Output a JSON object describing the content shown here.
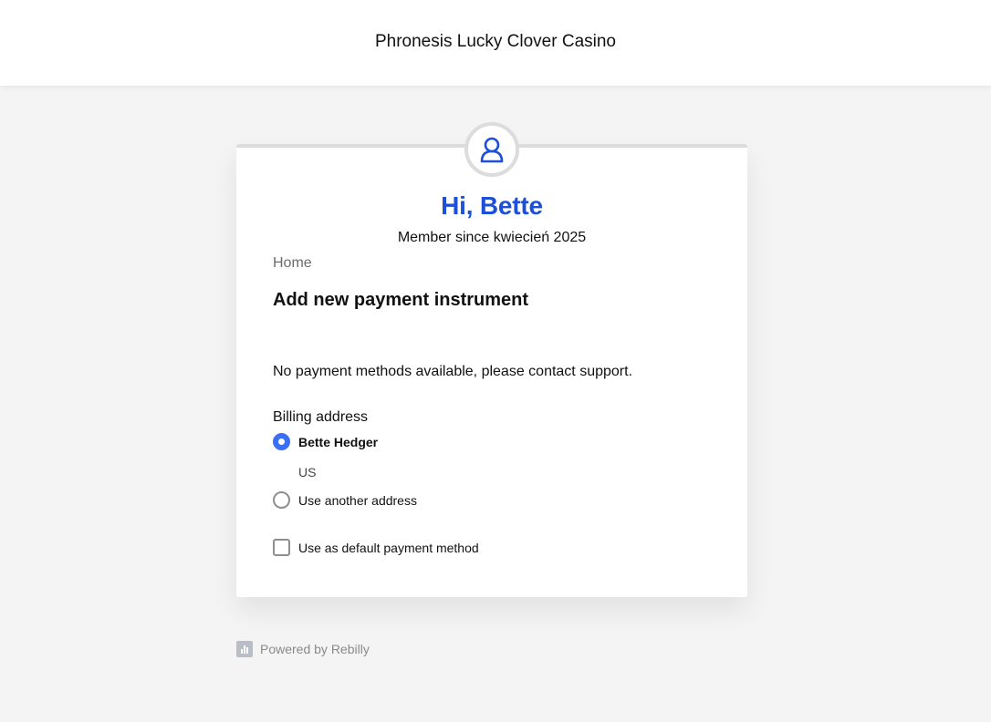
{
  "header": {
    "title": "Phronesis Lucky Clover Casino"
  },
  "profile": {
    "avatar_icon": "user-icon",
    "greeting": "Hi, Bette",
    "member_since": "Member since kwiecień 2025"
  },
  "breadcrumb": {
    "home": "Home"
  },
  "page": {
    "heading": "Add new payment instrument",
    "notice": "No payment methods available, please contact support."
  },
  "billing": {
    "label": "Billing address",
    "options": [
      {
        "label": "Bette Hedger",
        "detail": "US",
        "selected": true
      },
      {
        "label": "Use another address",
        "selected": false
      }
    ]
  },
  "default_payment": {
    "label": "Use as default payment method",
    "checked": false
  },
  "footer": {
    "powered_by": "Powered by Rebilly",
    "logo_icon": "rebilly-logo-icon"
  },
  "colors": {
    "accent": "#1d4fd8",
    "radio_selected": "#3b6ff5",
    "background": "#f4f4f4"
  }
}
